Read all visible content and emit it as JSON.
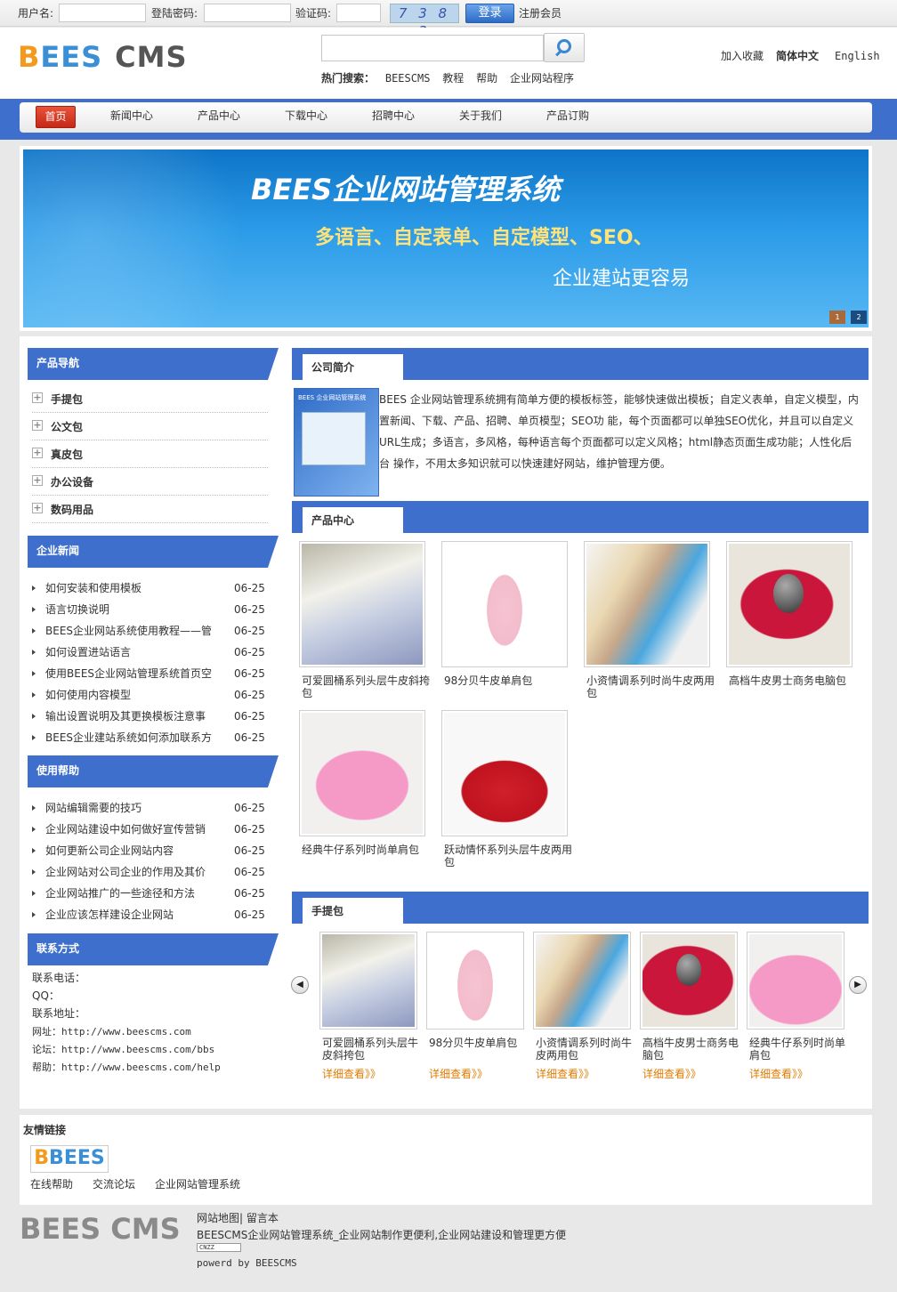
{
  "topbar": {
    "username_label": "用户名:",
    "password_label": "登陆密码:",
    "captcha_label": "验证码:",
    "captcha_text": "7 3 8 3",
    "login_button": "登录",
    "register_link": "注册会员"
  },
  "header": {
    "logo_b": "B",
    "logo_ees": "EES",
    "logo_cms": "CMS",
    "hot_search_label": "热门搜索：",
    "hot_search_terms": [
      "BEESCMS",
      "教程",
      "帮助",
      "企业网站程序"
    ],
    "top_links": [
      "加入收藏",
      "简体中文",
      "English"
    ]
  },
  "nav": {
    "items": [
      "首页",
      "新闻中心",
      "产品中心",
      "下载中心",
      "招聘中心",
      "关于我们",
      "产品订购"
    ]
  },
  "banner": {
    "title": "BEES企业网站管理系统",
    "line2": "多语言、自定表单、自定模型、SEO、",
    "line3": "企业建站更容易",
    "pages": [
      "1",
      "2"
    ]
  },
  "sidebar": {
    "product_nav_title": "产品导航",
    "categories": [
      "手提包",
      "公文包",
      "真皮包",
      "办公设备",
      "数码用品"
    ],
    "news_title": "企业新闻",
    "news": [
      {
        "title": "如何安装和使用模板",
        "date": "06-25"
      },
      {
        "title": "语言切换说明",
        "date": "06-25"
      },
      {
        "title": "BEES企业网站系统使用教程——管",
        "date": "06-25"
      },
      {
        "title": "如何设置进站语言",
        "date": "06-25"
      },
      {
        "title": "使用BEES企业网站管理系统首页空",
        "date": "06-25"
      },
      {
        "title": "如何使用内容模型",
        "date": "06-25"
      },
      {
        "title": "输出设置说明及其更换模板注意事",
        "date": "06-25"
      },
      {
        "title": "BEES企业建站系统如何添加联系方",
        "date": "06-25"
      }
    ],
    "help_title": "使用帮助",
    "help": [
      {
        "title": "网站编辑需要的技巧",
        "date": "06-25"
      },
      {
        "title": "企业网站建设中如何做好宣传营销",
        "date": "06-25"
      },
      {
        "title": "如何更新公司企业网站内容",
        "date": "06-25"
      },
      {
        "title": "企业网站对公司企业的作用及其价",
        "date": "06-25"
      },
      {
        "title": "企业网站推广的一些途径和方法",
        "date": "06-25"
      },
      {
        "title": "企业应该怎样建设企业网站",
        "date": "06-25"
      }
    ],
    "contact_title": "联系方式",
    "contact": [
      "联系电话：",
      "QQ：",
      "联系地址：",
      "网址：http://www.beescms.com",
      "论坛：http://www.beescms.com/bbs",
      "帮助：http://www.beescms.com/help"
    ]
  },
  "about": {
    "title": "公司简介",
    "box_label": "BEES 企业网站管理系统",
    "text": "BEES 企业网站管理系统拥有简单方便的模板标签，能够快速做出模板；自定义表单，自定义模型，内置新闻、下载、产品、招聘、单页模型；SEO功 能，每个页面都可以单独SEO优化，并且可以自定义URL生成；多语言，多风格，每种语言每个页面都可以定义风格；html静态页面生成功能；人性化后台 操作，不用太多知识就可以快速建好网站，维护管理方便。"
  },
  "products": {
    "title": "产品中心",
    "items": [
      "可爱圆桶系列头层牛皮斜挎包",
      "98分贝牛皮单肩包",
      "小资情调系列时尚牛皮两用包",
      "高档牛皮男士商务电脑包",
      "经典牛仔系列时尚单肩包",
      "跃动情怀系列头层牛皮两用包"
    ]
  },
  "handbags": {
    "title": "手提包",
    "items": [
      "可爱圆桶系列头层牛皮斜挎包",
      "98分贝牛皮单肩包",
      "小资情调系列时尚牛皮两用包",
      "高档牛皮男士商务电脑包",
      "经典牛仔系列时尚单肩包"
    ],
    "more_label": "详细查看》》"
  },
  "links": {
    "title": "友情链接",
    "logo_text": "BEES",
    "items": [
      "在线帮助",
      "交流论坛",
      "企业网站管理系统"
    ]
  },
  "footer": {
    "logo": "BEES CMS",
    "links": "网站地图| 留言本",
    "slogan": "BEESCMS企业网站管理系统_企业网站制作更便利,企业网站建设和管理更方便",
    "cnzz": "CNZZ",
    "powered": "powerd by BEESCMS"
  },
  "colors": {
    "accent_blue": "#3f6fcc",
    "nav_home_red": "#c52817",
    "more_orange": "#e07b00"
  }
}
